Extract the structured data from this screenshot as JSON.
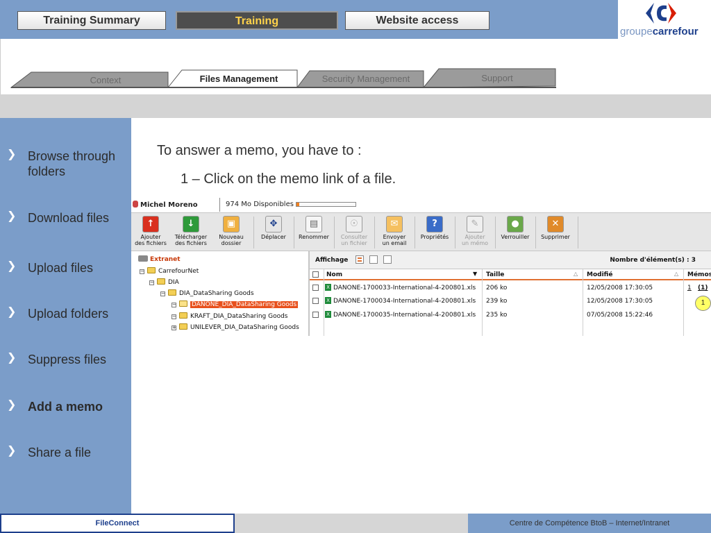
{
  "header": {
    "tabs": [
      {
        "label": "Training Summary",
        "active": false
      },
      {
        "label": "Training",
        "active": true
      },
      {
        "label": "Website access",
        "active": false
      }
    ],
    "logo": {
      "text_light": "groupe",
      "text_bold": "carrefour",
      "brand_color": "#1d3f8c"
    }
  },
  "subnav": {
    "tabs": [
      {
        "label": "Context",
        "active": false
      },
      {
        "label": "Files Management",
        "active": true
      },
      {
        "label": "Security Management",
        "active": false
      },
      {
        "label": "Support",
        "active": false
      }
    ]
  },
  "leftnav": {
    "items": [
      {
        "label": "Browse through folders",
        "bold": false
      },
      {
        "label": "Download files",
        "bold": false
      },
      {
        "label": "Upload files",
        "bold": false
      },
      {
        "label": "Upload folders",
        "bold": false
      },
      {
        "label": "Suppress files",
        "bold": false
      },
      {
        "label": "Add a memo",
        "bold": true
      },
      {
        "label": "Share a file",
        "bold": false
      }
    ]
  },
  "content": {
    "instruction_main": "To answer a memo, you have to :",
    "instruction_step": "1 – Click on the memo link of a file."
  },
  "app": {
    "user_name": "Michel Moreno",
    "quota_text": "974 Mo Disponibles",
    "quota_used": 0.05,
    "toolbar": [
      {
        "line1": "Ajouter",
        "line2": "des fichiers",
        "icon": "add-files-icon",
        "enabled": true
      },
      {
        "line1": "Télécharger",
        "line2": "des fichiers",
        "icon": "download-icon",
        "enabled": true
      },
      {
        "line1": "Nouveau",
        "line2": "dossier",
        "icon": "new-folder-icon",
        "enabled": true
      },
      {
        "line1": "Déplacer",
        "line2": "",
        "icon": "move-icon",
        "enabled": true
      },
      {
        "line1": "Renommer",
        "line2": "",
        "icon": "rename-icon",
        "enabled": true
      },
      {
        "line1": "Consulter",
        "line2": "un fichier",
        "icon": "view-file-icon",
        "enabled": false
      },
      {
        "line1": "Envoyer",
        "line2": "un email",
        "icon": "email-icon",
        "enabled": true
      },
      {
        "line1": "Propriétés",
        "line2": "",
        "icon": "properties-icon",
        "enabled": true
      },
      {
        "line1": "Ajouter",
        "line2": "un mémo",
        "icon": "add-memo-icon",
        "enabled": false
      },
      {
        "line1": "Verrouiller",
        "line2": "",
        "icon": "lock-icon",
        "enabled": true
      },
      {
        "line1": "Supprimer",
        "line2": "",
        "icon": "delete-icon",
        "enabled": true
      }
    ],
    "tree": {
      "root": "Extranet",
      "nodes": [
        {
          "label": "CarrefourNet",
          "toggle": "−"
        },
        {
          "label": "DIA",
          "toggle": "−"
        },
        {
          "label": "DIA_DataSharing Goods",
          "toggle": "−"
        },
        {
          "label": "DANONE_DIA_DataSharing Goods",
          "toggle": "−",
          "selected": true
        },
        {
          "label": "KRAFT_DIA_DataSharing Goods",
          "toggle": "−"
        },
        {
          "label": "UNILEVER_DIA_DataSharing Goods",
          "toggle": "+"
        }
      ]
    },
    "grid": {
      "view_label": "Affichage",
      "count_label": "Nombre d'élément(s) : 3",
      "columns": [
        "Nom",
        "Taille",
        "Modifié",
        "Mémos"
      ],
      "rows": [
        {
          "name": "DANONE-1700033-International-4-200801.xls",
          "size": "206 ko",
          "modified": "12/05/2008 17:30:05",
          "memo_count": "1",
          "memo_new": "(1)"
        },
        {
          "name": "DANONE-1700034-International-4-200801.xls",
          "size": "239 ko",
          "modified": "12/05/2008 17:30:05",
          "memo_count": "",
          "memo_new": ""
        },
        {
          "name": "DANONE-1700035-International-4-200801.xls",
          "size": "235 ko",
          "modified": "07/05/2008 15:22:46",
          "memo_count": "",
          "memo_new": ""
        }
      ]
    },
    "callout_number": "1"
  },
  "footer": {
    "left": "FileConnect",
    "right": "Centre de Compétence BtoB – Internet/Intranet"
  }
}
